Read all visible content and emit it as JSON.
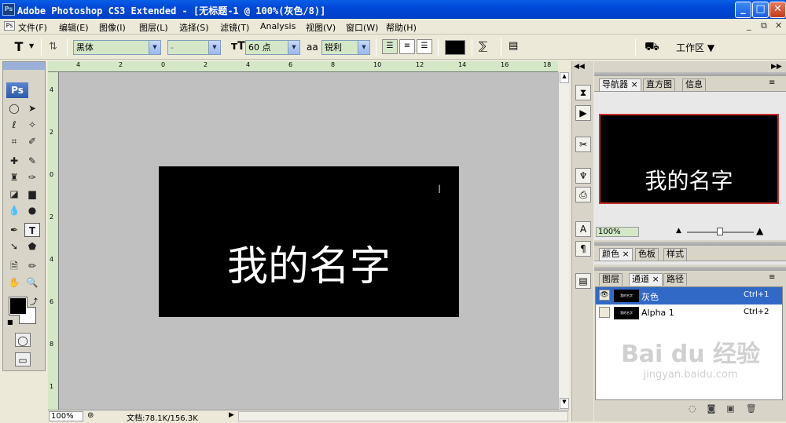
{
  "titlebar": {
    "title": "Adobe Photoshop CS3 Extended - [无标题-1 @ 100%(灰色/8)]",
    "app_icon": "Ps",
    "minimize": "_",
    "maximize": "□",
    "close": "✕"
  },
  "menu": {
    "items": [
      "文件(F)",
      "编辑(E)",
      "图像(I)",
      "图层(L)",
      "选择(S)",
      "滤镜(T)",
      "Analysis",
      "视图(V)",
      "窗口(W)",
      "帮助(H)"
    ],
    "doc_controls": [
      "_",
      "⧉",
      "✕"
    ]
  },
  "options": {
    "tool_icon": "T",
    "font_family": "黑体",
    "font_style": "-",
    "font_size": "60 点",
    "aa_label": "aa",
    "antialias": "锐利",
    "workspace": "工作区 ▼",
    "text_color": "#000000"
  },
  "ruler": {
    "top_ticks": [
      "4",
      "2",
      "0",
      "2",
      "4",
      "6",
      "8",
      "10",
      "12",
      "14",
      "16",
      "18"
    ],
    "left_ticks": [
      "4",
      "2",
      "0",
      "2",
      "4",
      "6",
      "8",
      "1"
    ]
  },
  "document": {
    "text": "我的名字",
    "background_color": "#000000",
    "text_color": "#ffffff"
  },
  "status": {
    "zoom": "100%",
    "doc_info": "文档:78.1K/156.3K"
  },
  "toolbox": {
    "logo": "Ps"
  },
  "navigator": {
    "tabs": [
      "导航器 ×",
      "直方图",
      "信息"
    ],
    "thumb_text": "我的名字",
    "zoom": "100%"
  },
  "color_panel": {
    "tabs": [
      "颜色 ×",
      "色板",
      "样式"
    ]
  },
  "channels": {
    "tabs": [
      "图层",
      "通道 ×",
      "路径"
    ],
    "rows": [
      {
        "name": "灰色",
        "shortcut": "Ctrl+1",
        "thumb": "我的名字"
      },
      {
        "name": "Alpha 1",
        "shortcut": "Ctrl+2",
        "thumb": "我的名字"
      }
    ]
  },
  "watermark": {
    "brand": "Bai du 经验",
    "url": "jingyan.baidu.com"
  }
}
